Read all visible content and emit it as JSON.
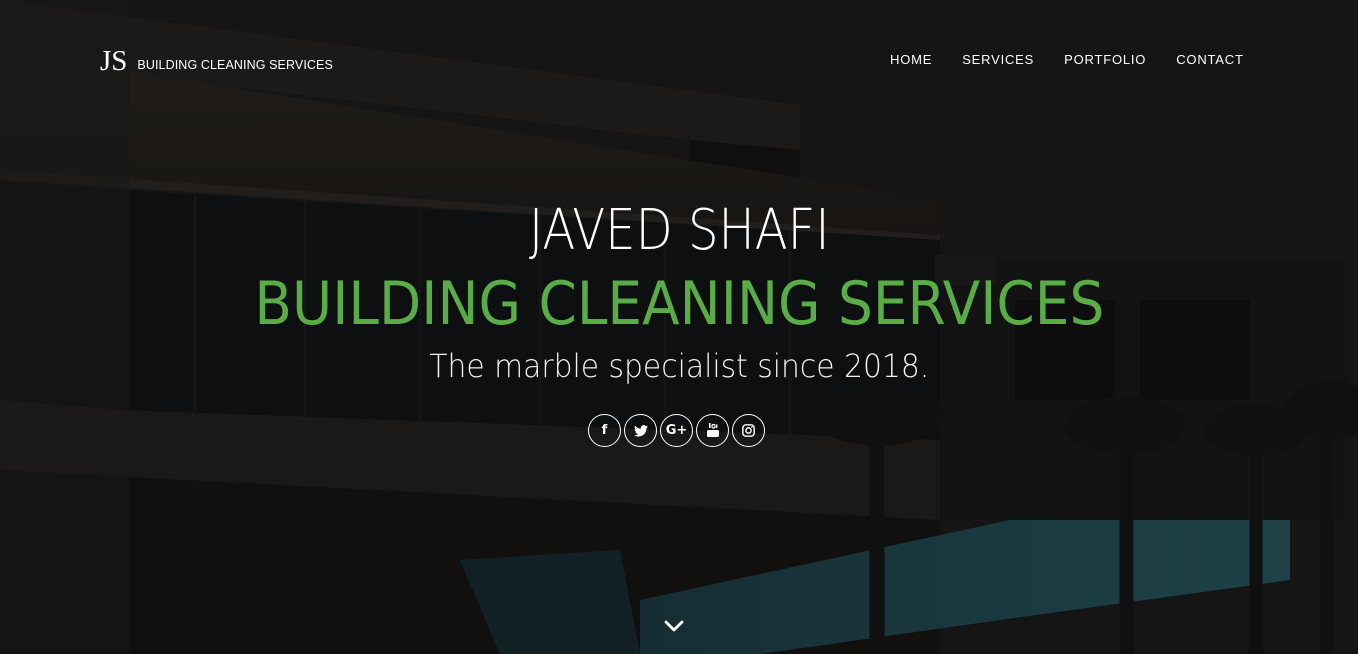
{
  "brand": {
    "mark": "JS",
    "name": "BUILDING CLEANING SERVICES"
  },
  "nav": {
    "items": [
      {
        "label": "HOME"
      },
      {
        "label": "SERVICES"
      },
      {
        "label": "PORTFOLIO"
      },
      {
        "label": "CONTACT"
      }
    ]
  },
  "hero": {
    "title_line1": "JAVED SHAFI",
    "title_line2": "BUILDING CLEANING SERVICES",
    "tagline": "The marble specialist since 2018."
  },
  "social": [
    {
      "icon": "facebook-icon",
      "glyph": "f"
    },
    {
      "icon": "twitter-icon",
      "glyph": ""
    },
    {
      "icon": "google-plus-icon",
      "glyph": "G+"
    },
    {
      "icon": "youtube-icon",
      "glyph": ""
    },
    {
      "icon": "instagram-icon",
      "glyph": ""
    }
  ],
  "colors": {
    "accent": "#5aac47",
    "text": "#ffffff",
    "background": "#161616"
  }
}
